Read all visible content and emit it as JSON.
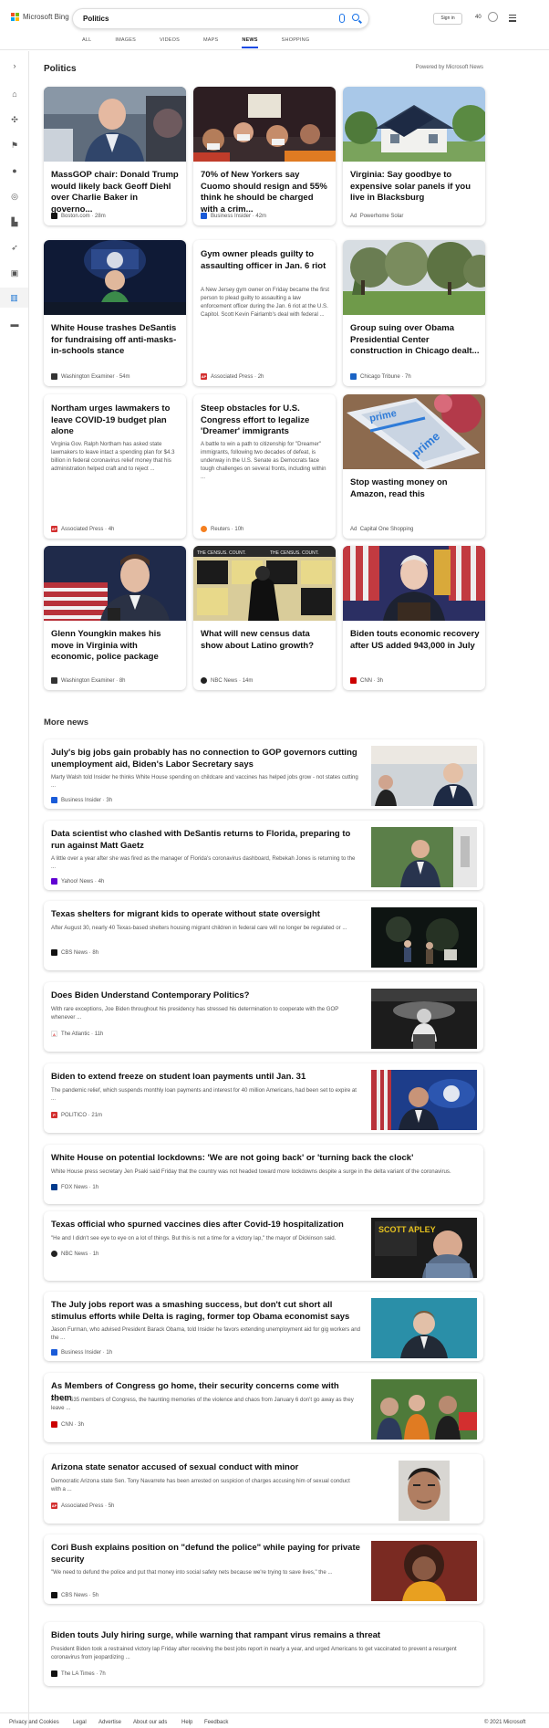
{
  "header": {
    "brand": "Microsoft Bing",
    "query": "Politics",
    "sign_in": "Sign in",
    "rewards": "40"
  },
  "tabs": [
    "ALL",
    "IMAGES",
    "VIDEOS",
    "MAPS",
    "NEWS",
    "SHOPPING"
  ],
  "section_title": "Politics",
  "powered_by": "Powered by Microsoft News",
  "cards": [
    {
      "title": "MassGOP chair: Donald Trump would likely back Geoff Diehl over Charlie Baker in governo...",
      "source": "Boston.com",
      "time": "28m"
    },
    {
      "title": "70% of New Yorkers say Cuomo should resign and 55% think he should be charged with a crim...",
      "source": "Business Insider",
      "time": "42m"
    },
    {
      "title": "Virginia: Say goodbye to expensive solar panels if you live in Blacksburg",
      "ad": "Ad",
      "source": "Powerhome Solar"
    },
    {
      "title": "White House trashes DeSantis for fundraising off anti-masks-in-schools stance",
      "source": "Washington Examiner",
      "time": "54m"
    },
    {
      "title": "Gym owner pleads guilty to assaulting officer in Jan. 6 riot",
      "desc": "A New Jersey gym owner on Friday became the first person to plead guilty to assaulting a law enforcement officer during the Jan. 6 riot at the U.S. Capitol. Scott Kevin Fairlamb's deal with federal ...",
      "source": "Associated Press",
      "time": "2h"
    },
    {
      "title": "Group suing over Obama Presidential Center construction in Chicago dealt...",
      "source": "Chicago Tribune",
      "time": "7h"
    },
    {
      "title": "Northam urges lawmakers to leave COVID-19 budget plan alone",
      "desc": "Virginia Gov. Ralph Northam has asked state lawmakers to leave intact a spending plan for $4.3 billion in federal coronavirus relief money that his administration helped craft and to reject ...",
      "source": "Associated Press",
      "time": "4h"
    },
    {
      "title": "Steep obstacles for U.S. Congress effort to legalize 'Dreamer' immigrants",
      "desc": "A battle to win a path to citizenship for \"Dreamer\" immigrants, following two decades of defeat, is underway in the U.S. Senate as Democrats face tough challenges on several fronts, including within ...",
      "source": "Reuters",
      "time": "10h"
    },
    {
      "title": "Stop wasting money on Amazon, read this",
      "ad": "Ad",
      "source": "Capital One Shopping",
      "img_text": "prime"
    },
    {
      "title": "Glenn Youngkin makes his move in Virginia with economic, police package",
      "source": "Washington Examiner",
      "time": "8h"
    },
    {
      "title": "What will new census data show about Latino growth?",
      "source": "NBC News",
      "time": "14m",
      "img_text": "THE CENSUS. COUNT."
    },
    {
      "title": "Biden touts economic recovery after US added 943,000 in July",
      "source": "CNN",
      "time": "3h"
    }
  ],
  "more_news_title": "More news",
  "more_news": [
    {
      "title": "July's big jobs gain probably has no connection to GOP governors cutting unemployment aid, Biden's Labor Secretary says",
      "desc": "Marty Walsh told Insider he thinks White House spending on childcare and vaccines has helped jobs grow - not states cutting ...",
      "source": "Business Insider",
      "time": "3h"
    },
    {
      "title": "Data scientist who clashed with DeSantis returns to Florida, preparing to run against Matt Gaetz",
      "desc": "A little over a year after she was fired as the manager of Florida's coronavirus dashboard, Rebekah Jones is returning to the ...",
      "source": "Yahoo! News",
      "time": "4h"
    },
    {
      "title": "Texas shelters for migrant kids to operate without state oversight",
      "desc": "After August 30, nearly 40 Texas-based shelters housing migrant children in federal care will no longer be regulated or ...",
      "source": "CBS News",
      "time": "8h"
    },
    {
      "title": "Does Biden Understand Contemporary Politics?",
      "desc": "With rare exceptions, Joe Biden throughout his presidency has stressed his determination to cooperate with the GOP whenever ...",
      "source": "The Atlantic",
      "time": "11h"
    },
    {
      "title": "Biden to extend freeze on student loan payments until Jan. 31",
      "desc": "The pandemic relief, which suspends monthly loan payments and interest for 40 million Americans, had been set to expire at ...",
      "source": "POLITICO",
      "time": "21m"
    },
    {
      "title": "White House on potential lockdowns: 'We are not going back' or 'turning back the clock'",
      "desc": "White House press secretary Jen Psaki said Friday that the country was not headed toward more lockdowns despite a surge in the delta variant of the coronavirus.",
      "source": "FOX News",
      "time": "1h"
    },
    {
      "title": "Texas official who spurned vaccines dies after Covid-19 hospitalization",
      "desc": "\"He and I didn't see eye to eye on a lot of things. But this is not a time for a victory lap,\" the mayor of Dickinson said.",
      "source": "NBC News",
      "time": "1h",
      "img_text": "SCOTT APLEY"
    },
    {
      "title": "The July jobs report was a smashing success, but don't cut short all stimulus efforts while Delta is raging, former top Obama economist says",
      "desc": "Jason Furman, who advised President Barack Obama, told Insider he favors extending unemployment aid for gig workers and the ...",
      "source": "Business Insider",
      "time": "1h"
    },
    {
      "title": "As Members of Congress go home, their security concerns come with them",
      "desc": "For the 535 members of Congress, the haunting memories of the violence and chaos from January 6 don't go away as they leave ...",
      "source": "CNN",
      "time": "3h"
    },
    {
      "title": "Arizona state senator accused of sexual conduct with minor",
      "desc": "Democratic Arizona state Sen. Tony Navarrete has been arrested on suspicion of charges accusing him of sexual conduct with a ...",
      "source": "Associated Press",
      "time": "5h"
    },
    {
      "title": "Cori Bush explains position on \"defund the police\" while paying for private security",
      "desc": "\"We need to defund the police and put that money into social safety nets because we're trying to save lives,\" the ...",
      "source": "CBS News",
      "time": "5h"
    },
    {
      "title": "Biden touts July hiring surge, while warning that rampant virus remains a threat",
      "desc": "President Biden took a restrained victory lap Friday after receiving the best jobs report in nearly a year, and urged Americans to get vaccinated to prevent a resurgent coronavirus from jeopardizing ...",
      "source": "The LA Times",
      "time": "7h"
    }
  ],
  "footer": {
    "links": [
      "Privacy and Cookies",
      "Legal",
      "Advertise",
      "About our ads",
      "Help",
      "Feedback"
    ],
    "copyright": "© 2021 Microsoft"
  },
  "colors": {
    "accent": "#174ae4",
    "rail_active": "#1672d3"
  }
}
